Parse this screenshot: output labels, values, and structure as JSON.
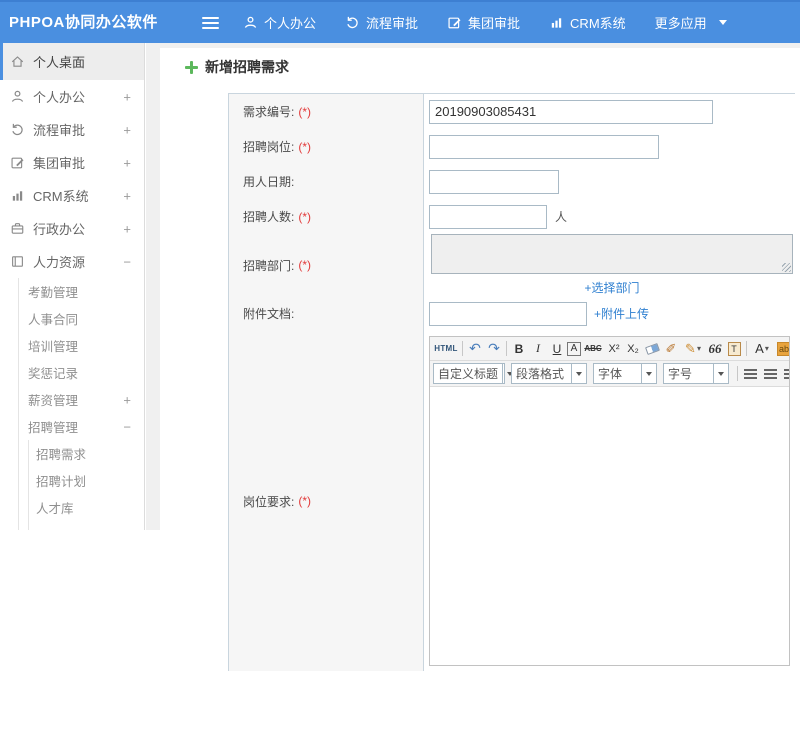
{
  "topbar": {
    "logo": "PHPOA协同办公软件",
    "nav": [
      {
        "label": "个人办公"
      },
      {
        "label": "流程审批"
      },
      {
        "label": "集团审批"
      },
      {
        "label": "CRM系统"
      },
      {
        "label": "更多应用"
      }
    ]
  },
  "sidebar": {
    "items": [
      {
        "label": "个人桌面"
      },
      {
        "label": "个人办公",
        "expander": "+"
      },
      {
        "label": "流程审批",
        "expander": "+"
      },
      {
        "label": "集团审批",
        "expander": "+"
      },
      {
        "label": "CRM系统",
        "expander": "+"
      },
      {
        "label": "行政办公",
        "expander": "+"
      },
      {
        "label": "人力资源",
        "expander": "−"
      },
      {
        "label": "考勤管理"
      },
      {
        "label": "人事合同"
      },
      {
        "label": "培训管理"
      },
      {
        "label": "奖惩记录"
      },
      {
        "label": "薪资管理",
        "expander": "+"
      },
      {
        "label": "招聘管理",
        "expander": "−"
      },
      {
        "label": "招聘需求"
      },
      {
        "label": "招聘计划"
      },
      {
        "label": "人才库"
      }
    ]
  },
  "main": {
    "title": "新增招聘需求",
    "form": {
      "rows": [
        {
          "label": "需求编号:",
          "required": "(*)",
          "value": "20190903085431"
        },
        {
          "label": "招聘岗位:",
          "required": "(*)",
          "value": ""
        },
        {
          "label": "用人日期:",
          "value": ""
        },
        {
          "label": "招聘人数:",
          "required": "(*)",
          "value": "",
          "suffix": "人"
        },
        {
          "label": "招聘部门:",
          "required": "(*)",
          "link": "+选择部门"
        },
        {
          "label": "附件文档:",
          "value": "",
          "link": "+附件上传"
        },
        {
          "label": "岗位要求:",
          "required": "(*)"
        }
      ]
    },
    "editor": {
      "source_label": "HTML",
      "undo_glyph": "↶",
      "redo_glyph": "↷",
      "bold_glyph": "B",
      "italic_glyph": "I",
      "underline_glyph": "U",
      "fontname_glyph": "A",
      "strike_glyph": "ABC",
      "sup_glyph": "X²",
      "sub_glyph": "X₂",
      "brush_glyph": "✐",
      "colorpen_glyph": "✎",
      "quote_glyph": "66",
      "paste_glyph": "T",
      "forecolor_glyph": "A",
      "hilite_glyph": "ab",
      "caret": "▾",
      "selects": {
        "heading": "自定义标题",
        "paragraph": "段落格式",
        "font": "字体",
        "size": "字号"
      }
    }
  },
  "colors": {
    "topbar_blue": "#4a8fe0",
    "link_blue": "#2e7fd0",
    "required_red": "#e23a3a",
    "plus_green": "#5cb85c"
  }
}
